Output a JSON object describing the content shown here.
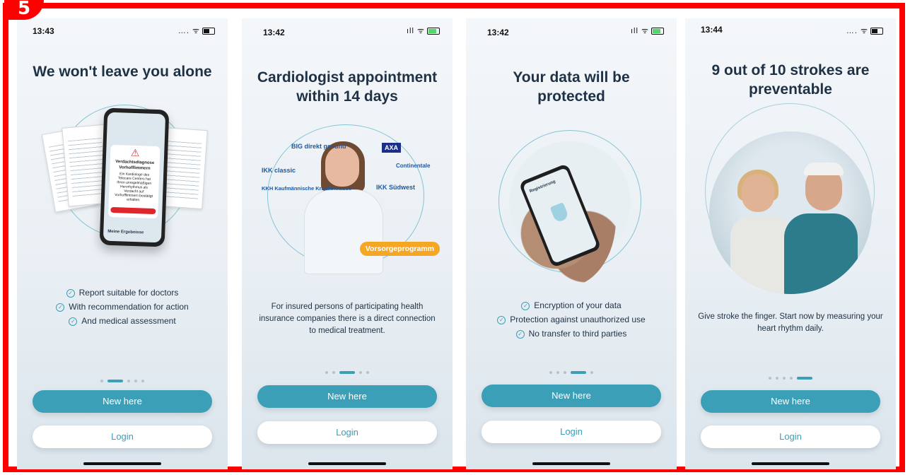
{
  "step_badge": "5",
  "screens": [
    {
      "status": {
        "time": "13:43",
        "icons": "…. ᯤ",
        "battery_charging": false
      },
      "title": "We won't leave you alone",
      "illustration": {
        "phone_card_title": "Verdachtsdiagnose Vorhofflimmern",
        "phone_card_text": "Ein Kardiologe des Telecare Centers hat Ihren unregelmäßigen Herzrhythmus als Verdacht auf Vorhofflimmern bestätigt erhalten.",
        "phone_bottom_label": "Meine Ergebnisse"
      },
      "checklist": [
        "Report suitable for doctors",
        "With recommendation for action",
        "And medical assessment"
      ],
      "dots_active_index": 1,
      "dots_count": 5,
      "primary_button": "New here",
      "secondary_button": "Login"
    },
    {
      "status": {
        "time": "13:42",
        "icons": "ıll ᯤ",
        "battery_charging": true
      },
      "title": "Cardiologist appointment within 14 days",
      "illustration": {
        "logos": [
          "BIG direkt gesund",
          "IKK classic",
          "KKH Kaufmännische Krankenkasse",
          "AXA",
          "Continentale",
          "IKK Südwest"
        ],
        "badge": "Vorsorgeprogramm"
      },
      "paragraph": "For insured persons of participating health insurance companies there is a direct connection to medical treatment.",
      "dots_active_index": 2,
      "dots_count": 5,
      "primary_button": "New here",
      "secondary_button": "Login"
    },
    {
      "status": {
        "time": "13:42",
        "icons": "ıll ᯤ",
        "battery_charging": true
      },
      "title": "Your data will be protected",
      "illustration": {
        "phone_screen_label": "Registrierung"
      },
      "checklist": [
        "Encryption of your data",
        "Protection against unauthorized use",
        "No transfer to third parties"
      ],
      "dots_active_index": 3,
      "dots_count": 5,
      "primary_button": "New here",
      "secondary_button": "Login"
    },
    {
      "status": {
        "time": "13:44",
        "icons": "…. ᯤ",
        "battery_charging": false
      },
      "title": "9 out of 10 strokes are preventable",
      "paragraph": "Give stroke the finger. Start now by measuring your heart rhythm daily.",
      "dots_active_index": 4,
      "dots_count": 5,
      "primary_button": "New here",
      "secondary_button": "Login"
    }
  ],
  "colors": {
    "frame": "#ff0000",
    "accent": "#3a9fb7",
    "title": "#1e3145",
    "badge_orange": "#f5a623",
    "warning_red": "#e0262d"
  }
}
